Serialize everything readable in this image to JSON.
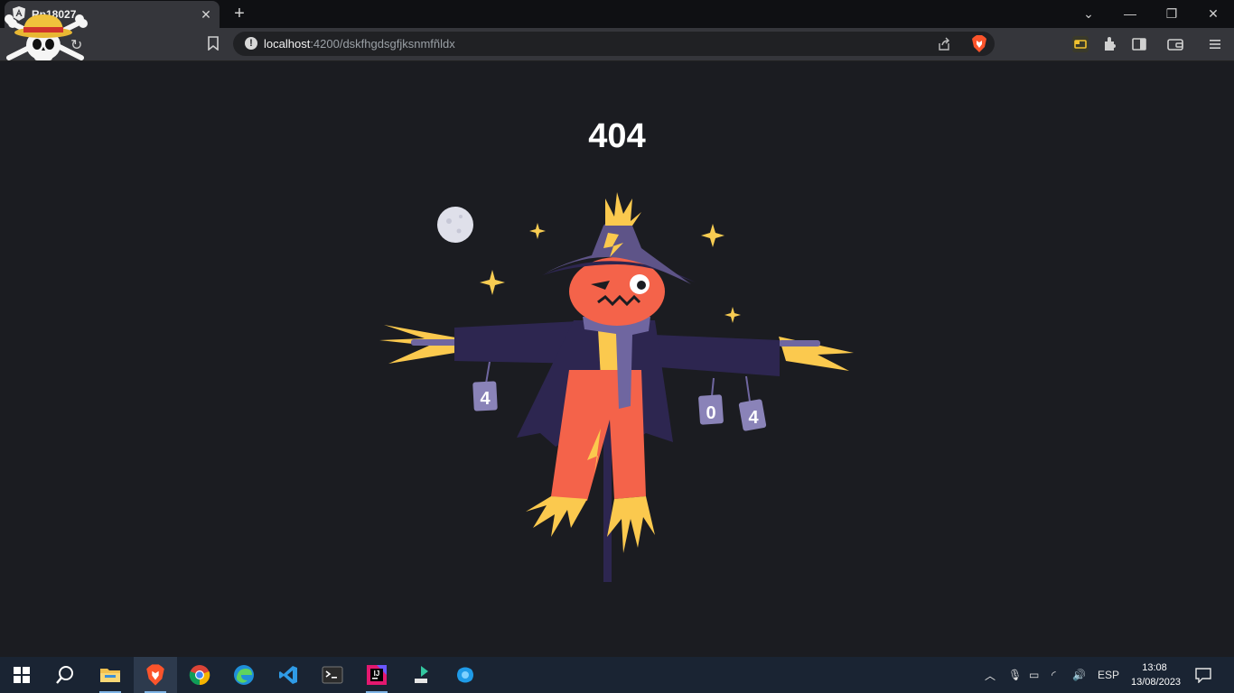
{
  "browser": {
    "tab": {
      "title": "Rp18027"
    },
    "address": {
      "host": "localhost",
      "path": ":4200/dskfhgdsgfjksnmfñldx"
    }
  },
  "page": {
    "title": "404",
    "illustration": {
      "can_labels": [
        "4",
        "0",
        "4"
      ]
    }
  },
  "taskbar": {
    "apps": [
      "start-icon",
      "search-icon",
      "file-explorer-icon",
      "brave-icon",
      "chrome-icon",
      "edge-icon",
      "vscode-icon",
      "terminal-icon",
      "jetbrains-icon",
      "git-client-icon",
      "app-icon"
    ],
    "tray": {
      "language": "ESP",
      "time": "13:08",
      "date": "13/08/2023"
    }
  },
  "colors": {
    "page_bg": "#1b1c21",
    "coat": "#2d2650",
    "hat": "#5e5488",
    "head": "#f4634a",
    "straw": "#fbc94e",
    "scarf": "#6f66a0",
    "pants": "#f4634a",
    "moon": "#dfe0ea",
    "star": "#f8cc52"
  }
}
